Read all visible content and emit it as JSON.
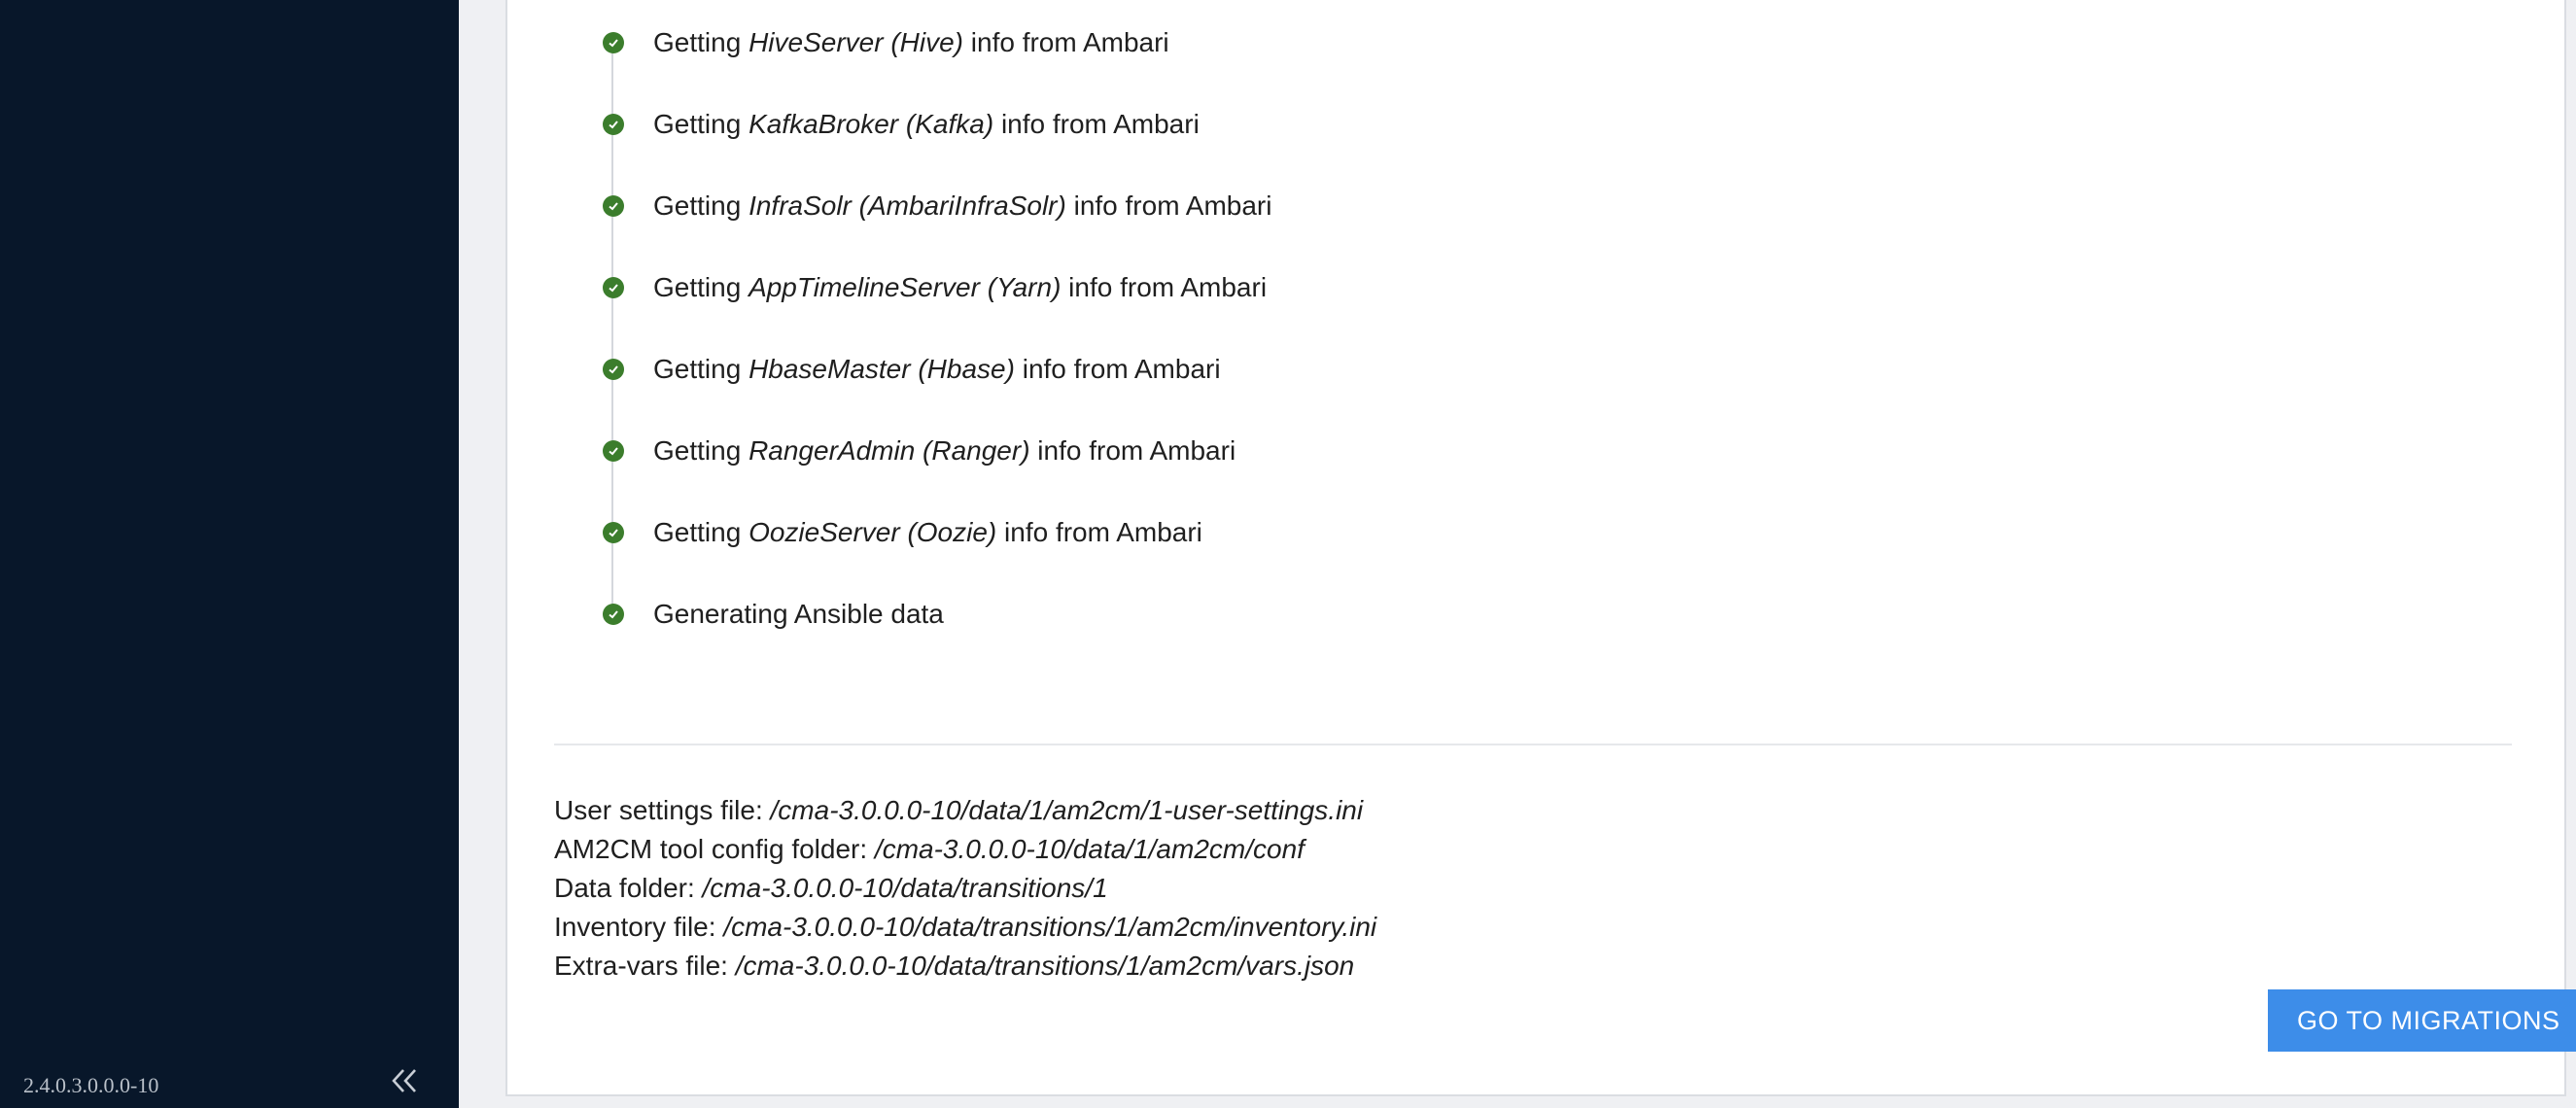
{
  "sidebar": {
    "version": "2.4.0.3.0.0.0-10",
    "collapse_icon": "double-chevron-left-icon"
  },
  "steps": [
    {
      "prefix": "Getting ",
      "name": "HiveServer (Hive)",
      "suffix": " info from Ambari",
      "status": "done"
    },
    {
      "prefix": "Getting ",
      "name": "KafkaBroker (Kafka)",
      "suffix": " info from Ambari",
      "status": "done"
    },
    {
      "prefix": "Getting ",
      "name": "InfraSolr (AmbariInfraSolr)",
      "suffix": " info from Ambari",
      "status": "done"
    },
    {
      "prefix": "Getting ",
      "name": "AppTimelineServer (Yarn)",
      "suffix": " info from Ambari",
      "status": "done"
    },
    {
      "prefix": "Getting ",
      "name": "HbaseMaster (Hbase)",
      "suffix": " info from Ambari",
      "status": "done"
    },
    {
      "prefix": "Getting ",
      "name": "RangerAdmin (Ranger)",
      "suffix": " info from Ambari",
      "status": "done"
    },
    {
      "prefix": "Getting ",
      "name": "OozieServer (Oozie)",
      "suffix": " info from Ambari",
      "status": "done"
    },
    {
      "prefix": "Generating Ansible data",
      "name": "",
      "suffix": "",
      "status": "done"
    }
  ],
  "files": [
    {
      "label": "User settings file: ",
      "path": "/cma-3.0.0.0-10/data/1/am2cm/1-user-settings.ini"
    },
    {
      "label": "AM2CM tool config folder: ",
      "path": "/cma-3.0.0.0-10/data/1/am2cm/conf"
    },
    {
      "label": "Data folder: ",
      "path": "/cma-3.0.0.0-10/data/transitions/1"
    },
    {
      "label": "Inventory file: ",
      "path": "/cma-3.0.0.0-10/data/transitions/1/am2cm/inventory.ini"
    },
    {
      "label": "Extra-vars file: ",
      "path": "/cma-3.0.0.0-10/data/transitions/1/am2cm/vars.json"
    }
  ],
  "actions": {
    "go_to_migrations": "GO TO MIGRATIONS"
  },
  "colors": {
    "sidebar_bg": "#08172a",
    "success_green": "#3b7d2c",
    "primary_button": "#3d8de9"
  }
}
